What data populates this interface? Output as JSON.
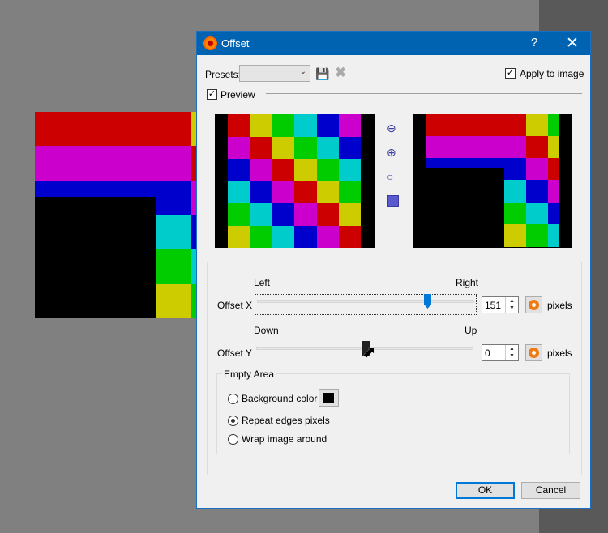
{
  "dialog": {
    "title": "Offset",
    "help": "?",
    "close": "✕"
  },
  "presets": {
    "label": "Presets:",
    "value": ""
  },
  "apply_to_image": {
    "label": "Apply to image",
    "checked": true
  },
  "preview": {
    "label": "Preview",
    "checked": true,
    "grid": [
      [
        "r",
        "y",
        "g",
        "c",
        "b",
        "m"
      ],
      [
        "m",
        "r",
        "y",
        "g",
        "c",
        "b"
      ],
      [
        "b",
        "m",
        "r",
        "y",
        "g",
        "c"
      ],
      [
        "c",
        "b",
        "m",
        "r",
        "y",
        "g"
      ],
      [
        "g",
        "c",
        "b",
        "m",
        "r",
        "y"
      ],
      [
        "y",
        "g",
        "c",
        "b",
        "m",
        "r"
      ]
    ]
  },
  "offset_x": {
    "label": "Offset X",
    "left": "Left",
    "right": "Right",
    "value": "151",
    "unit": "pixels",
    "slider_fraction": 0.75
  },
  "offset_y": {
    "label": "Offset Y",
    "left": "Down",
    "right": "Up",
    "value": "0",
    "unit": "pixels",
    "slider_fraction": 0.5
  },
  "empty_area": {
    "title": "Empty Area",
    "options": [
      {
        "label": "Background color",
        "selected": false
      },
      {
        "label": "Repeat edges pixels",
        "selected": true
      },
      {
        "label": "Wrap image around",
        "selected": false
      }
    ],
    "background_color": "#000000"
  },
  "buttons": {
    "ok": "OK",
    "cancel": "Cancel"
  },
  "colors": {
    "r": "#cc0000",
    "y": "#cccc00",
    "g": "#00cc00",
    "c": "#00cccc",
    "b": "#0000cc",
    "m": "#cc00cc",
    "accent": "#0063b1"
  }
}
